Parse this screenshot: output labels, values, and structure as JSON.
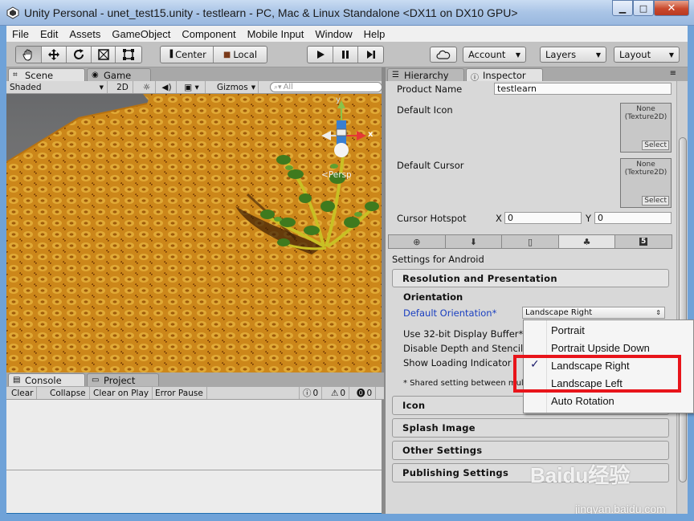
{
  "window": {
    "title": "Unity Personal - unet_test15.unity - testlearn - PC, Mac & Linux Standalone <DX11 on DX10 GPU>",
    "minimize": "▁",
    "maximize": "□",
    "close": "✕"
  },
  "menu": [
    "File",
    "Edit",
    "Assets",
    "GameObject",
    "Component",
    "Mobile Input",
    "Window",
    "Help"
  ],
  "toolbar": {
    "pivot": "Center",
    "space": "Local",
    "account": "Account",
    "layers": "Layers",
    "layout": "Layout"
  },
  "scene": {
    "tab_scene": "Scene",
    "tab_game": "Game",
    "shading": "Shaded",
    "mode_2d": "2D",
    "gizmos": "Gizmos",
    "search_placeholder": "All",
    "persp_label": "Persp",
    "axis_y": "y",
    "axis_x": "x"
  },
  "console": {
    "tab_console": "Console",
    "tab_project": "Project",
    "clear": "Clear",
    "collapse": "Collapse",
    "clear_on_play": "Clear on Play",
    "error_pause": "Error Pause",
    "info_count": "0",
    "warn_count": "0",
    "error_count": "0"
  },
  "inspector": {
    "tab_hierarchy": "Hierarchy",
    "tab_inspector": "Inspector",
    "product_name_label": "Product Name",
    "product_name_value": "testlearn",
    "default_icon_label": "Default Icon",
    "default_cursor_label": "Default Cursor",
    "texture_none": "None\n(Texture2D)",
    "select": "Select",
    "cursor_hotspot_label": "Cursor Hotspot",
    "hotspot_x_label": "X",
    "hotspot_x": "0",
    "hotspot_y_label": "Y",
    "hotspot_y": "0",
    "settings_for": "Settings for Android",
    "res_section": "Resolution and Presentation",
    "orientation_header": "Orientation",
    "default_orientation_label": "Default Orientation*",
    "default_orientation_value": "Landscape Right",
    "use32_label": "Use 32-bit Display Buffer*",
    "disable_depth_label": "Disable Depth and Stencil",
    "show_loading_label": "Show Loading Indicator",
    "shared_note": "* Shared setting between mul",
    "sections": [
      "Icon",
      "Splash Image",
      "Other Settings",
      "Publishing Settings"
    ]
  },
  "orientation_menu": {
    "options": [
      "Portrait",
      "Portrait Upside Down",
      "Landscape Right",
      "Landscape Left",
      "Auto Rotation"
    ],
    "selected": "Landscape Right",
    "checkmark": "✓"
  },
  "watermark": {
    "brand": "Baidu经验",
    "url": "jingyan.baidu.com"
  },
  "colors": {
    "highlight": "#e8141a",
    "section_link": "#1a3fc0"
  }
}
